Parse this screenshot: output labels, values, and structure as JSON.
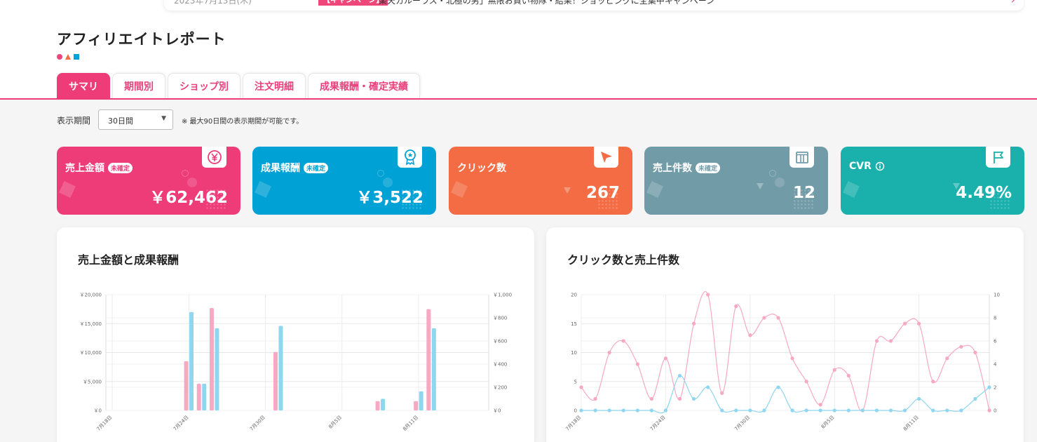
{
  "notice": {
    "date": "2023年7月13日(木)",
    "tag": "【キャンペーン】",
    "message": "楽天カルーラス・北極の男」無限お買い物隊・結果！ショッピングに全集中キャンペーン"
  },
  "page": {
    "title": "アフィリエイトレポート"
  },
  "tabs": [
    {
      "label": "サマリ"
    },
    {
      "label": "期間別"
    },
    {
      "label": "ショップ別"
    },
    {
      "label": "注文明細"
    },
    {
      "label": "成果報酬・確定実績"
    }
  ],
  "period": {
    "label": "表示期間",
    "selected": "30日間",
    "note": "※ 最大90日間の表示期間が可能です。"
  },
  "cards": [
    {
      "label": "売上金額",
      "badge": "未確定",
      "value": "￥62,462",
      "color": "#ee3c79",
      "icon": "yen-icon"
    },
    {
      "label": "成果報酬",
      "badge": "未確定",
      "value": "￥3,522",
      "color": "#00a2d5",
      "icon": "ribbon-icon"
    },
    {
      "label": "クリック数",
      "badge": "",
      "value": "267",
      "color": "#f36c44",
      "icon": "cursor-icon"
    },
    {
      "label": "売上件数",
      "badge": "未確定",
      "value": "12",
      "color": "#729ba8",
      "icon": "box-icon"
    },
    {
      "label": "CVR",
      "badge": "",
      "value": "4.49%",
      "color": "#1ab0ac",
      "icon": "flag-icon"
    }
  ],
  "chart_data": [
    {
      "type": "bar",
      "title": "売上金額と成果報酬",
      "x": [
        "7月18日",
        "7月19日",
        "7月20日",
        "7月21日",
        "7月22日",
        "7月23日",
        "7月24日",
        "7月25日",
        "7月26日",
        "7月27日",
        "7月28日",
        "7月29日",
        "7月30日",
        "7月31日",
        "8月1日",
        "8月2日",
        "8月3日",
        "8月4日",
        "8月5日",
        "8月6日",
        "8月7日",
        "8月8日",
        "8月9日",
        "8月10日",
        "8月11日",
        "8月12日",
        "8月13日",
        "8月14日",
        "8月15日",
        "8月16日"
      ],
      "xticks": [
        "7月18日",
        "7月24日",
        "7月30日",
        "8月5日",
        "8月11日"
      ],
      "series": [
        {
          "axis": "left",
          "color": "#f7a8c2",
          "values": [
            0,
            0,
            0,
            0,
            0,
            0,
            8500,
            4600,
            17700,
            0,
            0,
            0,
            0,
            10100,
            0,
            0,
            0,
            0,
            0,
            0,
            0,
            1600,
            0,
            0,
            1600,
            17500,
            0,
            0,
            0,
            0
          ]
        },
        {
          "axis": "right",
          "color": "#8fd6f0",
          "values": [
            0,
            0,
            0,
            0,
            0,
            0,
            850,
            230,
            710,
            0,
            0,
            0,
            0,
            730,
            0,
            0,
            0,
            0,
            0,
            0,
            0,
            100,
            0,
            0,
            165,
            710,
            0,
            0,
            0,
            0
          ]
        }
      ],
      "ylim_left": [
        0,
        20000
      ],
      "yticks_left": [
        "￥0",
        "￥5,000",
        "￥10,000",
        "￥15,000",
        "￥20,000"
      ],
      "ylim_right": [
        0,
        1000
      ],
      "yticks_right": [
        "￥0",
        "￥200",
        "￥400",
        "￥600",
        "￥800",
        "￥1,000"
      ],
      "grid": true
    },
    {
      "type": "line",
      "title": "クリック数と売上件数",
      "x": [
        "7月18日",
        "7月19日",
        "7月20日",
        "7月21日",
        "7月22日",
        "7月23日",
        "7月24日",
        "7月25日",
        "7月26日",
        "7月27日",
        "7月28日",
        "7月29日",
        "7月30日",
        "7月31日",
        "8月1日",
        "8月2日",
        "8月3日",
        "8月4日",
        "8月5日",
        "8月6日",
        "8月7日",
        "8月8日",
        "8月9日",
        "8月10日",
        "8月11日",
        "8月12日",
        "8月13日",
        "8月14日",
        "8月15日",
        "8月16日"
      ],
      "xticks": [
        "7月18日",
        "7月24日",
        "7月30日",
        "8月5日",
        "8月11日"
      ],
      "series": [
        {
          "axis": "left",
          "color": "#f7a8c2",
          "values": [
            4,
            2,
            10,
            12,
            8,
            2,
            9,
            2,
            15,
            20,
            3,
            18,
            13,
            16,
            16,
            9,
            5,
            1,
            7,
            6,
            0,
            12,
            12,
            15,
            15,
            5,
            9,
            11,
            10,
            0
          ]
        },
        {
          "axis": "right",
          "color": "#8fd6f0",
          "values": [
            0,
            0,
            0,
            0,
            0,
            0,
            0,
            3,
            1,
            2,
            0,
            0,
            0,
            0,
            2,
            0,
            0,
            0,
            0,
            0,
            0,
            0,
            0,
            0,
            1,
            0,
            0,
            0,
            1,
            2
          ]
        }
      ],
      "ylim_left": [
        0,
        20
      ],
      "yticks_left": [
        "0",
        "5",
        "10",
        "15",
        "20"
      ],
      "ylim_right": [
        0,
        10
      ],
      "yticks_right": [
        "0",
        "2",
        "4",
        "6",
        "8",
        "10"
      ],
      "grid": true
    }
  ]
}
